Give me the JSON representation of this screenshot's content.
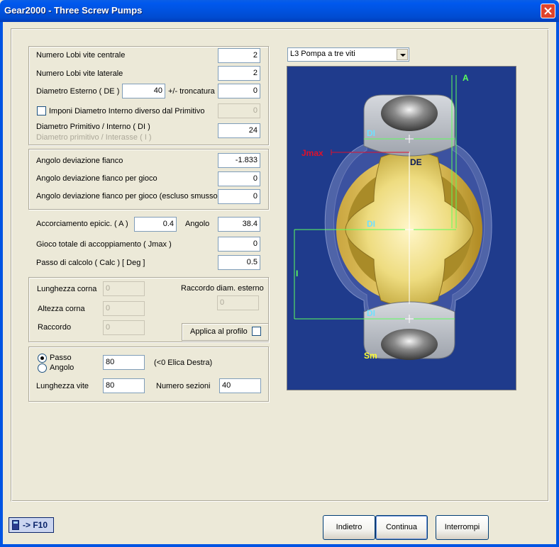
{
  "window": {
    "title": "Gear2000 - Three Screw Pumps"
  },
  "group1": {
    "lobi_centrale_label": "Numero Lobi vite centrale",
    "lobi_centrale_value": "2",
    "lobi_laterale_label": "Numero Lobi vite laterale",
    "lobi_laterale_value": "2",
    "diametro_esterno_label": "Diametro Esterno ( DE )",
    "diametro_esterno_value": "40",
    "troncatura_label": "+/- troncatura",
    "troncatura_value": "0",
    "imponi_label": "Imponi Diametro Interno diverso dal Primitivo",
    "imponi_value": "0",
    "diametro_primitivo_label": "Diametro Primitivo / Interno  ( DI )",
    "interasse_label": "Diametro primitivo / Interasse ( I )",
    "diametro_primitivo_value": "24"
  },
  "group2": {
    "angolo_fianco_label": "Angolo deviazione fianco",
    "angolo_fianco_value": "-1.833",
    "angolo_gioco_label": "Angolo deviazione fianco per gioco",
    "angolo_gioco_value": "0",
    "angolo_escluso_label": "Angolo deviazione fianco per gioco (escluso smusso)",
    "angolo_escluso_value": "0"
  },
  "group3": {
    "accorciamento_label": "Accorciamento epicic. ( A )",
    "accorciamento_value": "0.4",
    "angolo_label": "Angolo",
    "angolo_value": "38.4",
    "gioco_label": "Gioco totale di accoppiamento ( Jmax )",
    "gioco_value": "0",
    "passo_label": "Passo di calcolo ( Calc ) [ Deg ]",
    "passo_value": "0.5"
  },
  "group4": {
    "lunghezza_corna_label": "Lunghezza corna",
    "lunghezza_corna_value": "0",
    "raccordo_diam_label": "Raccordo diam. esterno",
    "raccordo_diam_value": "0",
    "altezza_corna_label": "Altezza corna",
    "altezza_corna_value": "0",
    "raccordo_label": "Raccordo",
    "raccordo_value": "0",
    "applica_label": "Applica al profilo"
  },
  "group5": {
    "passo_radio_label": "Passo",
    "angolo_radio_label": "Angolo",
    "passo_value": "80",
    "elica_note": "(<0 Elica Destra)",
    "lunghezza_vite_label": "Lunghezza vite",
    "lunghezza_vite_value": "80",
    "numero_sezioni_label": "Numero sezioni",
    "numero_sezioni_value": "40"
  },
  "pump_select": {
    "selected": "L3 Pompa a tre viti"
  },
  "diagram": {
    "label_A": "A",
    "label_DI_top": "DI",
    "label_Jmax": "Jmax",
    "label_DE": "DE",
    "label_DI_mid": "DI",
    "label_I": "I",
    "label_DI_bottom": "DI",
    "label_Sm": "Sm",
    "colors": {
      "background": "#1f3b8c",
      "housing": "#4f64a8",
      "rotor_center": "#eedc80",
      "rotor_side": "#b8bdc6",
      "dimension_line": "#5cff5c",
      "label_cyan": "#6fe0ff",
      "label_red": "#e0102a",
      "label_yellow": "#ffff30"
    }
  },
  "footer": {
    "calc_label": "-> F10",
    "indietro": "Indietro",
    "continua": "Continua",
    "interrompi": "Interrompi"
  }
}
